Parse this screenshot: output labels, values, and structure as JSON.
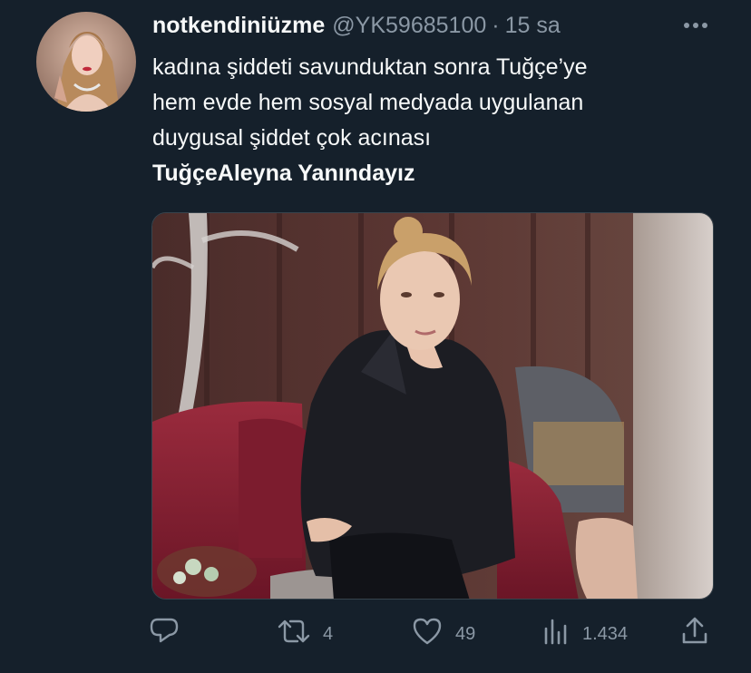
{
  "tweet": {
    "display_name": "notkendiniüzme",
    "handle": "@YK59685100",
    "separator": "·",
    "time": "15 sa",
    "avatar_icon": "user-avatar",
    "more_icon": "more-options-icon",
    "text_lines": [
      "kadına şiddeti savunduktan sonra Tuğçe’ye",
      "hem evde hem sosyal medyada uygulanan",
      "duygusal şiddet çok acınası"
    ],
    "hashtag_line": "TuğçeAleyna Yanındayız",
    "media": {
      "icon": "photo-woman-on-red-sofa"
    },
    "actions": {
      "reply": {
        "icon": "reply-icon",
        "count": ""
      },
      "retweet": {
        "icon": "retweet-icon",
        "count": "4"
      },
      "like": {
        "icon": "heart-icon",
        "count": "49"
      },
      "views": {
        "icon": "views-icon",
        "count": "1.434"
      },
      "share": {
        "icon": "share-icon",
        "count": ""
      }
    },
    "colors": {
      "background": "#15202b",
      "primary_text": "#f7f9f9",
      "secondary_text": "#8b98a5"
    }
  }
}
